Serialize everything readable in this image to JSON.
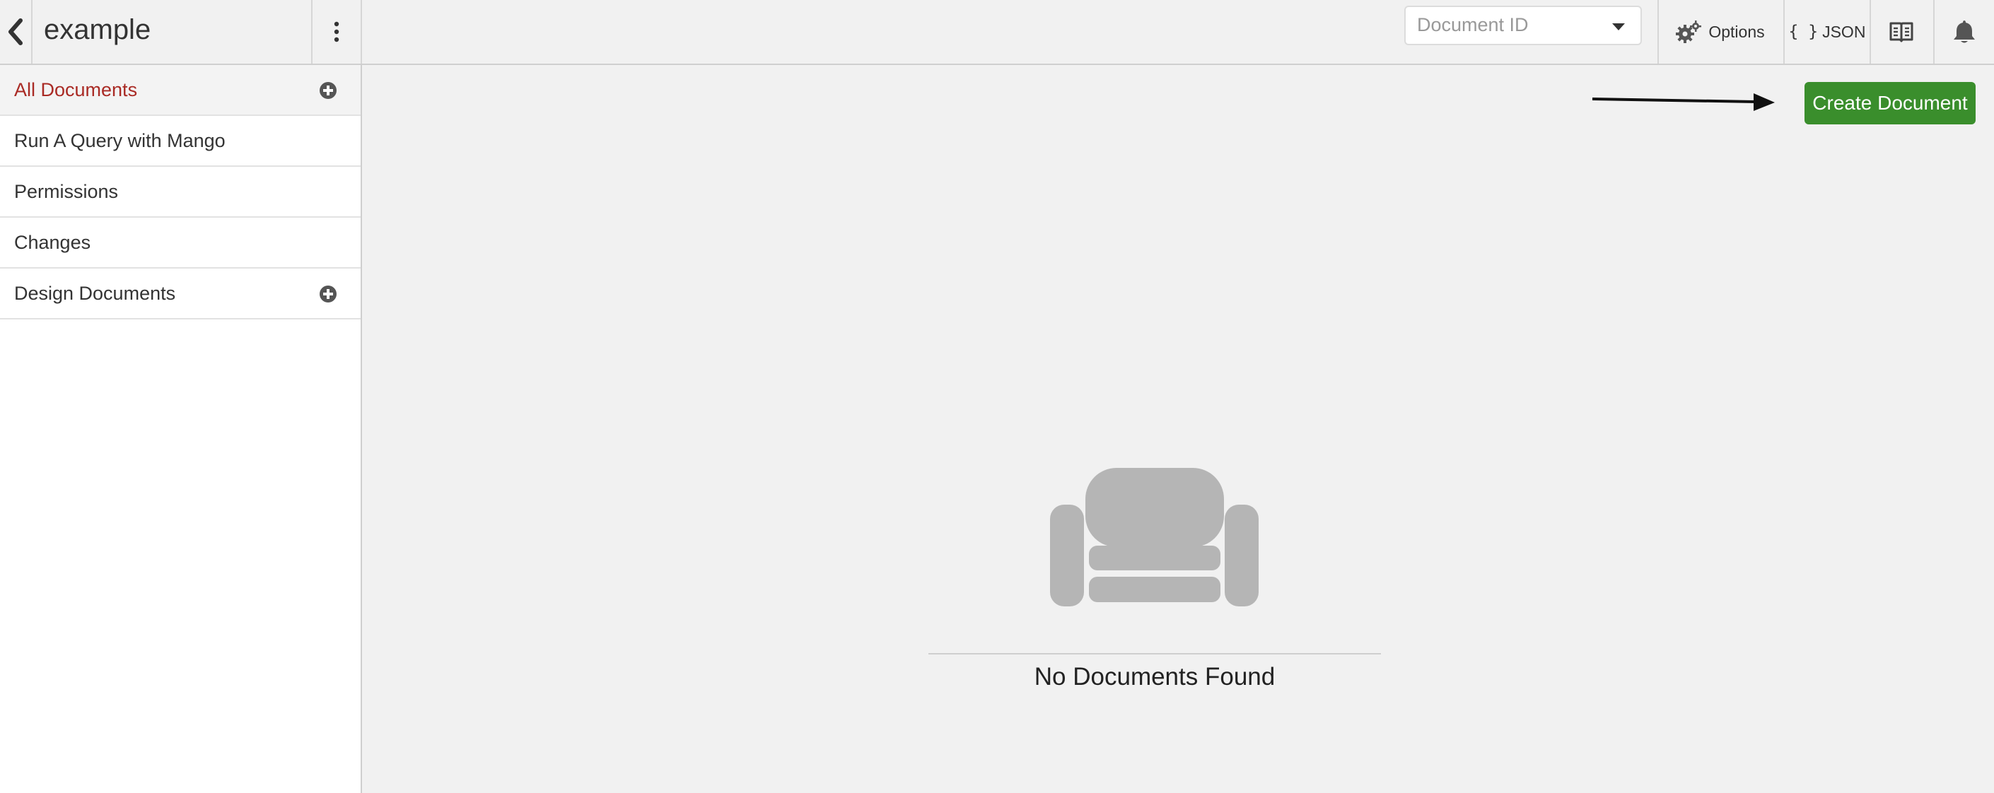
{
  "header": {
    "db_title": "example",
    "doc_id_placeholder": "Document ID",
    "options_label": "Options",
    "json_braces": "{ }",
    "json_label": "JSON"
  },
  "sidebar": {
    "items": [
      {
        "label": "All Documents",
        "active": true,
        "has_add": true
      },
      {
        "label": "Run A Query with Mango",
        "active": false,
        "has_add": false
      },
      {
        "label": "Permissions",
        "active": false,
        "has_add": false
      },
      {
        "label": "Changes",
        "active": false,
        "has_add": false
      },
      {
        "label": "Design Documents",
        "active": false,
        "has_add": true
      }
    ]
  },
  "main": {
    "create_button_label": "Create Document",
    "empty_message": "No Documents Found"
  },
  "colors": {
    "active_nav": "#a92a24",
    "create_button": "#3a8e2c",
    "couch_icon": "#b5b5b5"
  }
}
